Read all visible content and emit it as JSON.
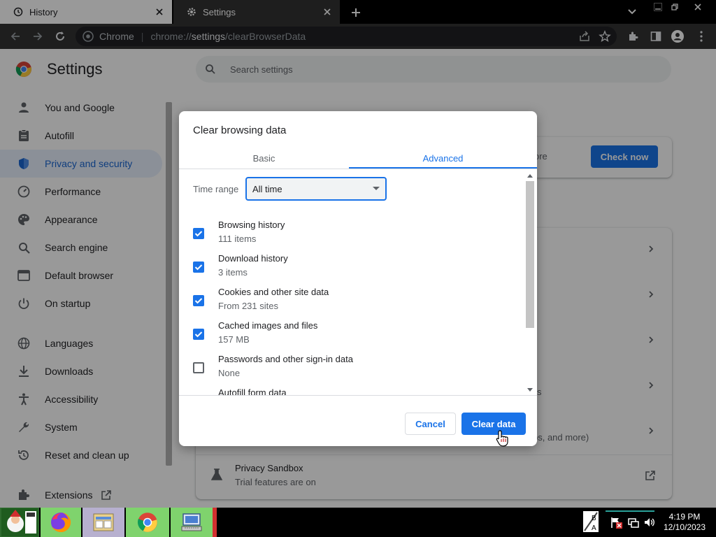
{
  "tabs": [
    {
      "title": "History",
      "icon": "history-icon",
      "active": false
    },
    {
      "title": "Settings",
      "icon": "gear-icon",
      "active": true
    }
  ],
  "omnibox": {
    "chip": "Chrome",
    "url_prefix": "chrome://",
    "url_host": "settings",
    "url_path": "/clearBrowserData"
  },
  "settings": {
    "title": "Settings",
    "search_placeholder": "Search settings",
    "sidebar": [
      {
        "label": "You and Google",
        "icon": "person-icon"
      },
      {
        "label": "Autofill",
        "icon": "clipboard-icon"
      },
      {
        "label": "Privacy and security",
        "icon": "shield-icon",
        "selected": true
      },
      {
        "label": "Performance",
        "icon": "speedometer-icon"
      },
      {
        "label": "Appearance",
        "icon": "palette-icon"
      },
      {
        "label": "Search engine",
        "icon": "search-icon"
      },
      {
        "label": "Default browser",
        "icon": "browser-icon"
      },
      {
        "label": "On startup",
        "icon": "power-icon"
      },
      {
        "label": "Languages",
        "icon": "globe-icon"
      },
      {
        "label": "Downloads",
        "icon": "download-icon"
      },
      {
        "label": "Accessibility",
        "icon": "accessibility-icon"
      },
      {
        "label": "System",
        "icon": "wrench-icon"
      },
      {
        "label": "Reset and clean up",
        "icon": "reset-icon"
      },
      {
        "label": "Extensions",
        "icon": "puzzle-icon"
      }
    ],
    "check_now_label": "Check now",
    "safety_fragment": "ore",
    "partial_s": "s",
    "partial_more": "ps, and more)",
    "privacy_sandbox_title": "Privacy Sandbox",
    "privacy_sandbox_sub": "Trial features are on"
  },
  "dialog": {
    "title": "Clear browsing data",
    "tab_basic": "Basic",
    "tab_advanced": "Advanced",
    "time_range_label": "Time range",
    "time_range_value": "All time",
    "options": [
      {
        "label": "Browsing history",
        "sub": "111 items",
        "checked": true
      },
      {
        "label": "Download history",
        "sub": "3 items",
        "checked": true
      },
      {
        "label": "Cookies and other site data",
        "sub": "From 231 sites",
        "checked": true
      },
      {
        "label": "Cached images and files",
        "sub": "157 MB",
        "checked": true
      },
      {
        "label": "Passwords and other sign-in data",
        "sub": "None",
        "checked": false
      },
      {
        "label": "Autofill form data",
        "sub": "",
        "checked": false
      }
    ],
    "cancel_label": "Cancel",
    "clear_label": "Clear data"
  },
  "taskbar": {
    "time": "4:19 PM",
    "date": "12/10/2023",
    "apps": [
      "santa-app-icon",
      "firefox-icon",
      "file-manager-icon",
      "chrome-icon",
      "network-computer-icon"
    ]
  },
  "colors": {
    "accent": "#1a73e8",
    "selected_bg": "#e8f0fe"
  }
}
